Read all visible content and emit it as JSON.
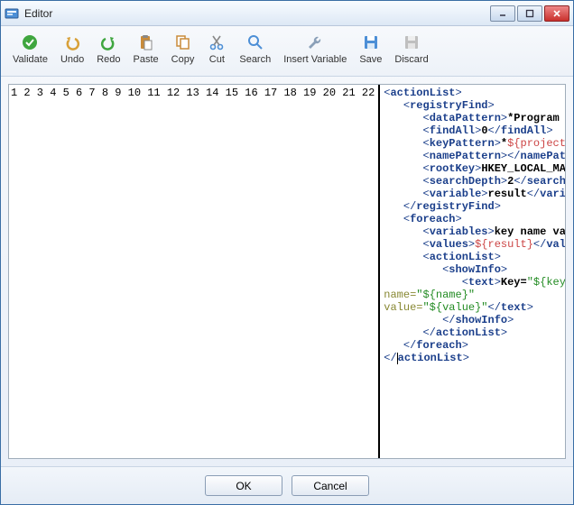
{
  "window": {
    "title": "Editor"
  },
  "toolbar": {
    "validate": "Validate",
    "undo": "Undo",
    "redo": "Redo",
    "paste": "Paste",
    "copy": "Copy",
    "cut": "Cut",
    "search": "Search",
    "insertVariable": "Insert Variable",
    "save": "Save",
    "discard": "Discard"
  },
  "buttons": {
    "ok": "OK",
    "cancel": "Cancel"
  },
  "editor": {
    "lineCount": 22,
    "lines": [
      {
        "n": 1,
        "indent": 0,
        "type": "open",
        "tag": "actionList"
      },
      {
        "n": 2,
        "indent": 1,
        "type": "open",
        "tag": "registryFind"
      },
      {
        "n": 3,
        "indent": 2,
        "type": "pair",
        "tag": "dataPattern",
        "content": [
          {
            "k": "text",
            "v": "*Program Files*"
          }
        ]
      },
      {
        "n": 4,
        "indent": 2,
        "type": "pair",
        "tag": "findAll",
        "content": [
          {
            "k": "text",
            "v": "0"
          }
        ]
      },
      {
        "n": 5,
        "indent": 2,
        "type": "pair",
        "tag": "keyPattern",
        "content": [
          {
            "k": "text",
            "v": "*"
          },
          {
            "k": "var",
            "v": "${project.fullName}"
          },
          {
            "k": "text",
            "v": "*"
          }
        ]
      },
      {
        "n": 6,
        "indent": 2,
        "type": "pair",
        "tag": "namePattern",
        "content": []
      },
      {
        "n": 7,
        "indent": 2,
        "type": "pair",
        "tag": "rootKey",
        "content": [
          {
            "k": "text",
            "v": "HKEY_LOCAL_MACHINE\\SOFTWARE"
          }
        ]
      },
      {
        "n": 8,
        "indent": 2,
        "type": "pair",
        "tag": "searchDepth",
        "content": [
          {
            "k": "text",
            "v": "2"
          }
        ]
      },
      {
        "n": 9,
        "indent": 2,
        "type": "pair",
        "tag": "variable",
        "content": [
          {
            "k": "text",
            "v": "result"
          }
        ]
      },
      {
        "n": 10,
        "indent": 1,
        "type": "close",
        "tag": "registryFind"
      },
      {
        "n": 11,
        "indent": 1,
        "type": "open",
        "tag": "foreach"
      },
      {
        "n": 12,
        "indent": 2,
        "type": "pair",
        "tag": "variables",
        "content": [
          {
            "k": "text",
            "v": "key name value"
          }
        ]
      },
      {
        "n": 13,
        "indent": 2,
        "type": "pair",
        "tag": "values",
        "content": [
          {
            "k": "var",
            "v": "${result}"
          }
        ]
      },
      {
        "n": 14,
        "indent": 2,
        "type": "open",
        "tag": "actionList"
      },
      {
        "n": 15,
        "indent": 3,
        "type": "open",
        "tag": "showInfo"
      },
      {
        "n": 16,
        "indent": 4,
        "type": "raw",
        "html": "<span class='t-punct'>&lt;</span><span class='t-tag'>text</span><span class='t-punct'>&gt;</span><span class='t-text'>Key=</span><span class='t-str'>\"${key}\"</span>"
      },
      {
        "n": 17,
        "indent": 0,
        "type": "raw",
        "html": "<span class='t-attr'>name=</span><span class='t-str'>\"${name}\"</span>"
      },
      {
        "n": 18,
        "indent": 0,
        "type": "raw",
        "html": "<span class='t-attr'>value=</span><span class='t-str'>\"${value}\"</span><span class='t-punct'>&lt;/</span><span class='t-close'>text</span><span class='t-punct'>&gt;</span>"
      },
      {
        "n": 19,
        "indent": 3,
        "type": "close",
        "tag": "showInfo"
      },
      {
        "n": 20,
        "indent": 2,
        "type": "close",
        "tag": "actionList"
      },
      {
        "n": 21,
        "indent": 1,
        "type": "close",
        "tag": "foreach"
      },
      {
        "n": 22,
        "indent": 0,
        "type": "closecaret",
        "tag": "actionList"
      }
    ]
  }
}
